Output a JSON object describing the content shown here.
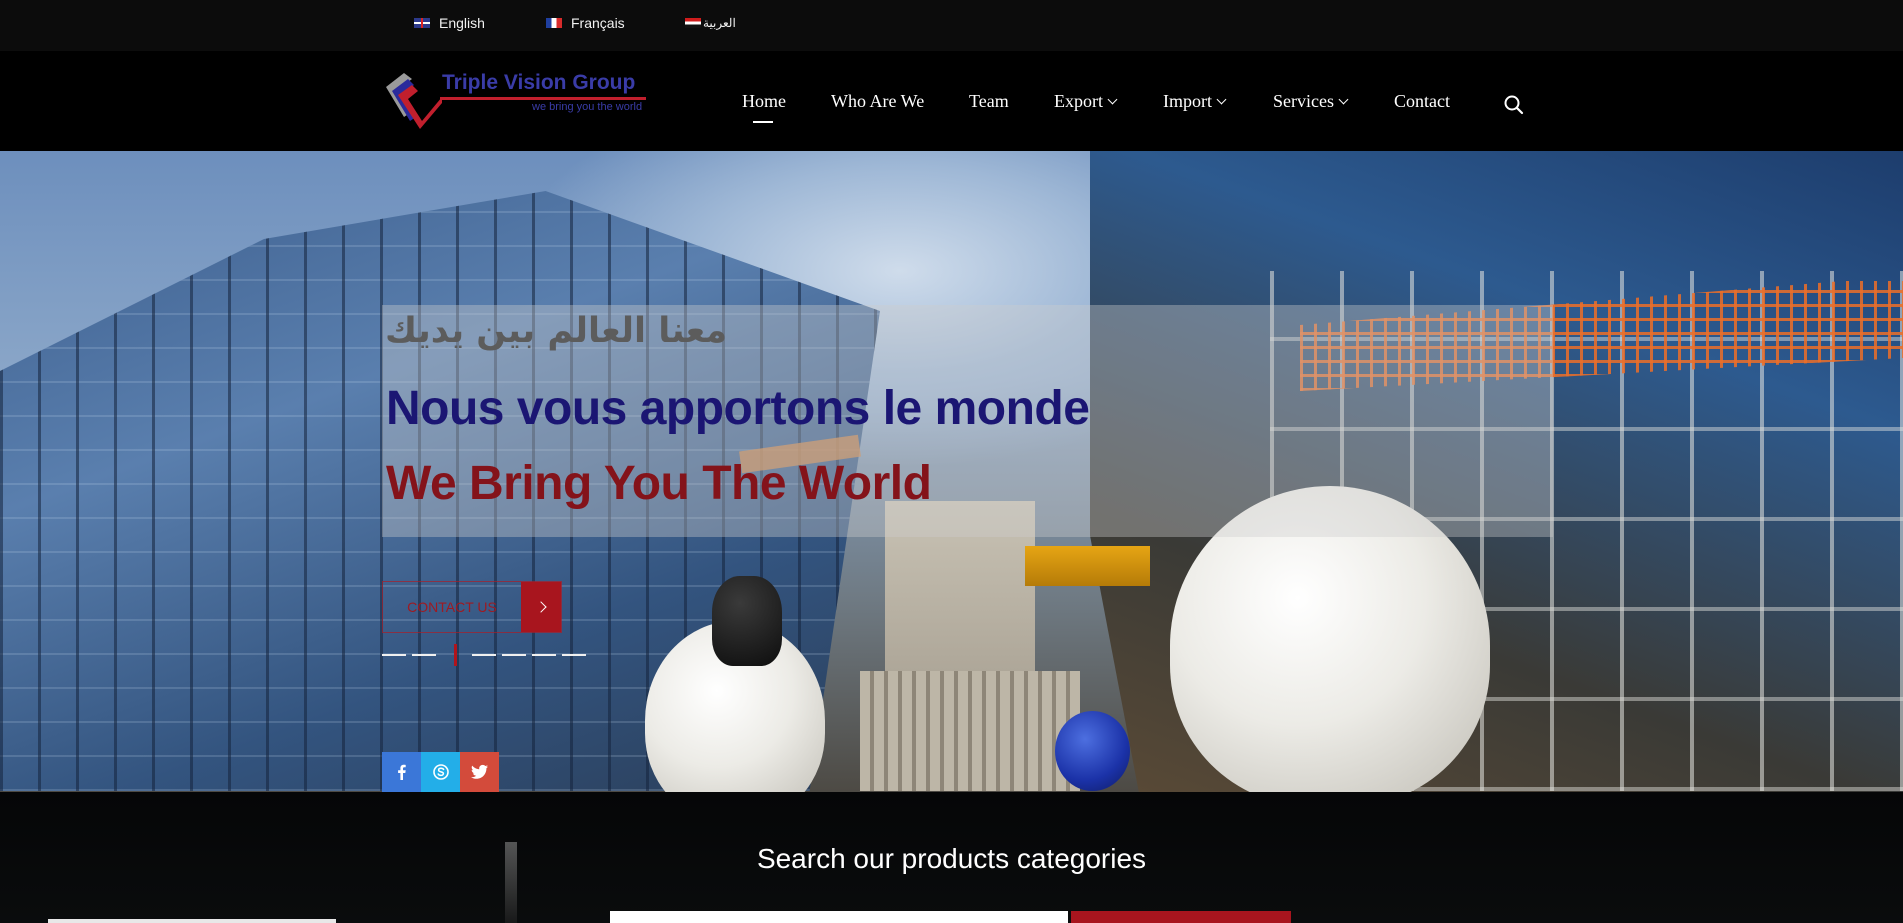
{
  "languages": [
    {
      "label": "English",
      "flag": "uk-flag-icon"
    },
    {
      "label": "Français",
      "flag": "france-flag-icon"
    },
    {
      "label": "العربية",
      "flag": "egypt-flag-icon"
    }
  ],
  "logo": {
    "title": "Triple Vision Group",
    "tagline": "we bring you the world"
  },
  "nav": {
    "items": [
      {
        "label": "Home",
        "active": true,
        "dropdown": false
      },
      {
        "label": "Who Are We",
        "active": false,
        "dropdown": false
      },
      {
        "label": "Team",
        "active": false,
        "dropdown": false
      },
      {
        "label": "Export",
        "active": false,
        "dropdown": true
      },
      {
        "label": "Import",
        "active": false,
        "dropdown": true
      },
      {
        "label": "Services",
        "active": false,
        "dropdown": true
      },
      {
        "label": "Contact",
        "active": false,
        "dropdown": false
      }
    ],
    "search_icon": "search-icon"
  },
  "hero": {
    "line_ar": "معنا العالم بين يديك",
    "line_fr": "Nous vous apportons le monde",
    "line_en": "We Bring You The World",
    "cta_label": "CONTACT US",
    "slides_count": 7,
    "active_slide": 3
  },
  "social": [
    "facebook-icon",
    "skype-icon",
    "twitter-icon"
  ],
  "products": {
    "title": "Search our products categories"
  },
  "colors": {
    "brand_blue": "#1b1673",
    "brand_red": "#84131a",
    "accent_red": "#a8151e"
  }
}
